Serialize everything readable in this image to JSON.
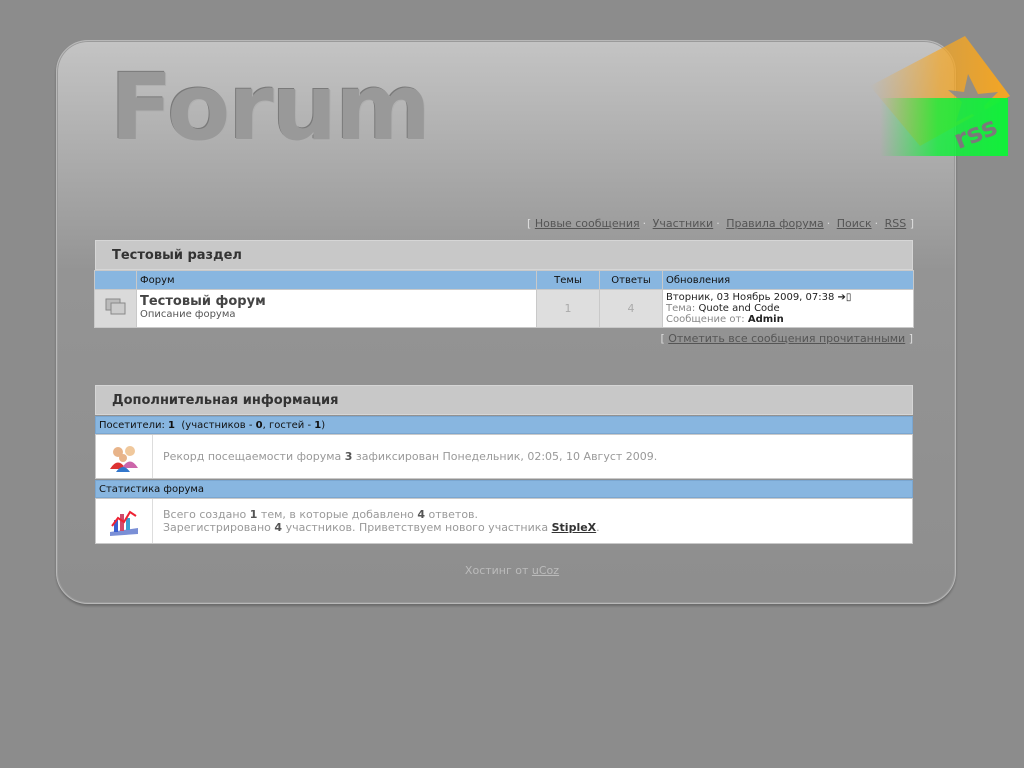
{
  "logo": {
    "text": "Forum"
  },
  "rss": {
    "label": "rss"
  },
  "nav": {
    "open": "[",
    "close": "]",
    "items": [
      "Новые сообщения",
      "Участники",
      "Правила форума",
      "Поиск",
      "RSS"
    ]
  },
  "category": {
    "title": "Тестовый раздел"
  },
  "table": {
    "headers": {
      "forum": "Форум",
      "topics": "Темы",
      "replies": "Ответы",
      "updates": "Обновления"
    },
    "rows": [
      {
        "title": "Тестовый форум",
        "description": "Описание форума",
        "topics": "1",
        "replies": "4",
        "last_date": "Вторник, 03 Ноябрь 2009, 07:38",
        "topic_label": "Тема:",
        "topic_value": "Quote and Code",
        "author_label": "Сообщение от:",
        "author_value": "Admin"
      }
    ]
  },
  "mark_read": {
    "label": "Отметить все сообщения прочитанными"
  },
  "info": {
    "title": "Дополнительная информация",
    "visitors_prefix": "Посетители:",
    "visitors_total": "1",
    "members_prefix": "(участников -",
    "members_count": "0",
    "guests_prefix": ", гостей -",
    "guests_count": "1",
    "close_paren": ")",
    "record_prefix": "Рекорд посещаемости форума",
    "record_count": "3",
    "record_suffix": "зафиксирован Понедельник, 02:05, 10 Август 2009.",
    "stats_title": "Статистика форума",
    "stats_prefix": "Всего создано",
    "stats_topics": "1",
    "stats_mid": "тем, в которые добавлено",
    "stats_replies": "4",
    "stats_suffix": "ответов.",
    "reg_prefix": "Зарегистрировано",
    "reg_count": "4",
    "reg_mid": "участников. Приветствуем нового участника",
    "reg_user": "StipleX",
    "reg_end": "."
  },
  "footer": {
    "prefix": "Хостинг от",
    "link": "uCoz"
  },
  "colors": {
    "header_blue": "#88b6e0",
    "background": "#8c8c8c",
    "rss_green": "#11f03a",
    "rss_orange": "#f5a623"
  }
}
